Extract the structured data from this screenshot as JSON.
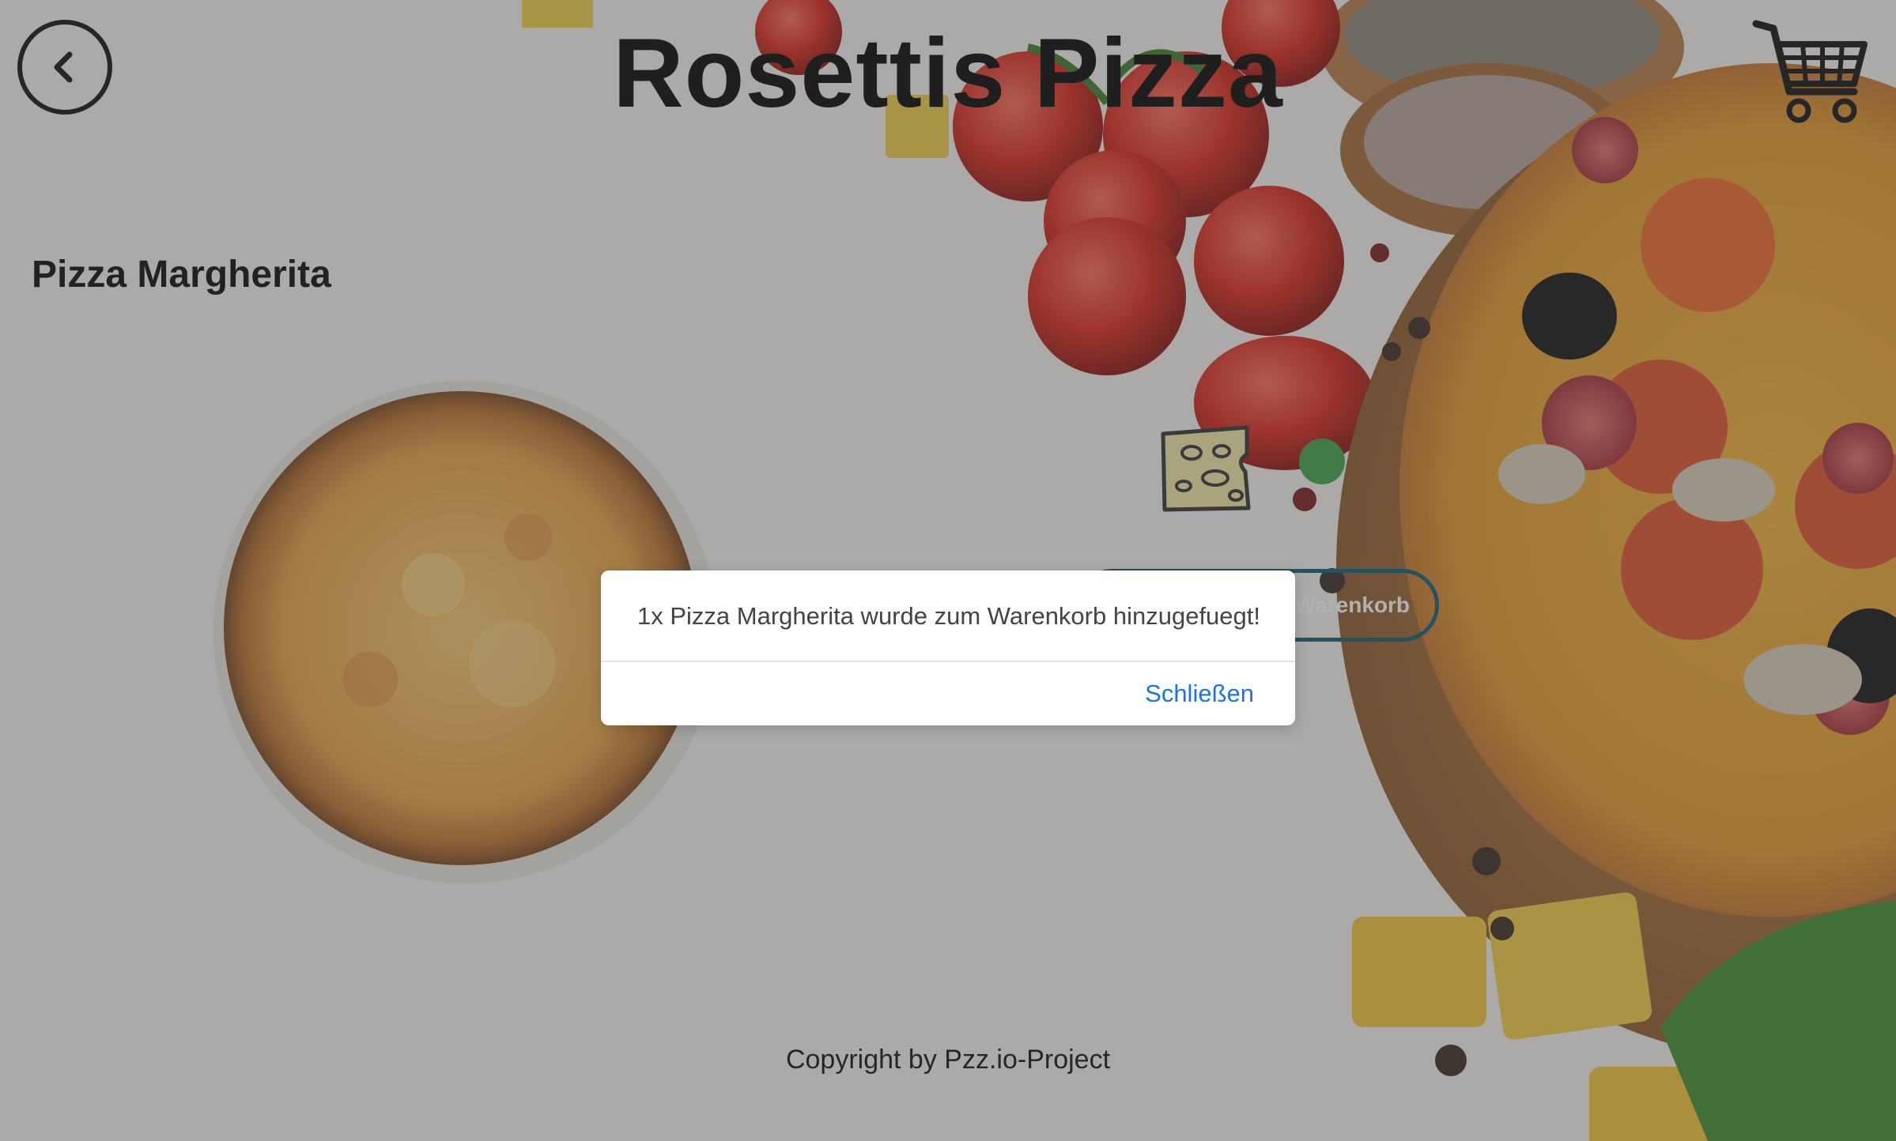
{
  "header": {
    "title": "Rosettis Pizza",
    "back_icon": "chevron-left-icon",
    "cart_icon": "shopping-cart-icon"
  },
  "product": {
    "name": "Pizza Margherita",
    "topping_icon": "cheese-icon",
    "status_color": "#3ea34a",
    "add_button_label": "Warenkorb"
  },
  "footer": {
    "copyright": "Copyright by Pzz.io-Project"
  },
  "modal": {
    "message": "1x Pizza Margherita wurde zum Warenkorb hinzugefuegt!",
    "close_label": "Schließen",
    "close_color": "#1a73e8"
  },
  "colors": {
    "button_border": "#0f5c78",
    "title": "#050505"
  }
}
